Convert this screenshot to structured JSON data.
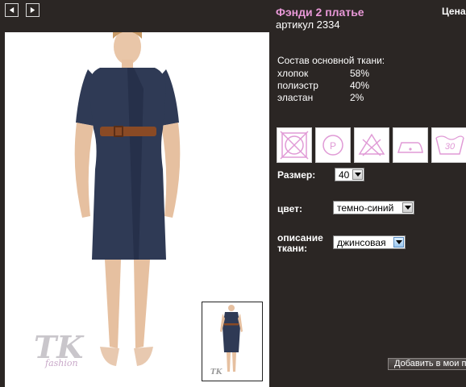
{
  "product": {
    "title": "Фэнди 2 платье",
    "article": "артикул 2334",
    "price_label": "Цена"
  },
  "fabric": {
    "heading": "Состав основной ткани:",
    "rows": [
      {
        "name": "хлопок",
        "percent": "58%"
      },
      {
        "name": "полиэстр",
        "percent": "40%"
      },
      {
        "name": "эластан",
        "percent": "2%"
      }
    ]
  },
  "care_icons": [
    "no-wash-icon",
    "dry-clean-p-icon",
    "no-bleach-icon",
    "iron-low-icon",
    "wash-30-icon"
  ],
  "care_wash_temp": "30",
  "dry_clean_letter": "P",
  "options": {
    "size_label": "Размер:",
    "size_value": "40",
    "color_label": "цвет:",
    "color_value": "темно-синий",
    "fabric_label": "описание ткани:",
    "fabric_value": "джинсовая"
  },
  "cart_button": "Добавить в мои п",
  "watermark": {
    "logo": "TK",
    "sub": "fashion"
  },
  "colors": {
    "title": "#e898d7",
    "background": "#2b2624",
    "dress": "#2f3a55",
    "belt": "#8a4a25"
  }
}
